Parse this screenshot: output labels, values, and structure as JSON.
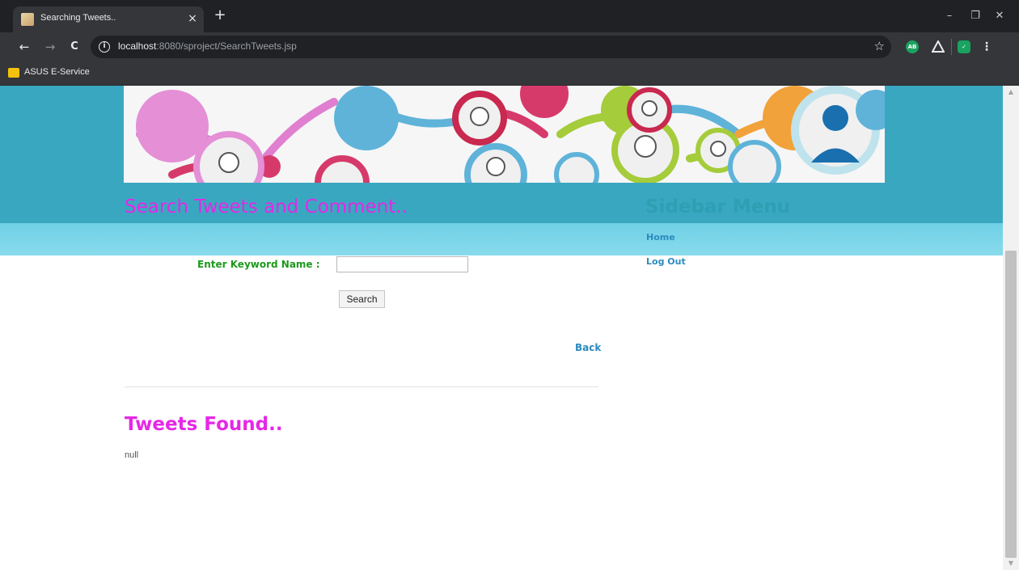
{
  "browser": {
    "tab_title": "Searching Tweets..",
    "tab_close": "×",
    "new_tab": "+",
    "url_host": "localhost",
    "url_rest": ":8080/sproject/SearchTweets.jsp",
    "bookmark": "ASUS E-Service",
    "window_controls": {
      "minimize": "–",
      "restore": "❐",
      "close": "✕"
    },
    "nav": {
      "back": "←",
      "forward": "→",
      "reload": "C"
    },
    "extension_ab": "AB"
  },
  "main": {
    "title": "Search Tweets and Comment..",
    "keyword_label": "Enter Keyword Name :",
    "keyword_value": "",
    "search_button": "Search",
    "back_link": "Back",
    "results_title": "Tweets Found..",
    "results_text": "null"
  },
  "sidebar": {
    "title": "Sidebar Menu",
    "items": [
      {
        "label": "Home"
      },
      {
        "label": "Log Out"
      }
    ]
  },
  "colors": {
    "heading_magenta": "#e528e6",
    "label_green": "#1c9a1c",
    "link_blue": "#2a8bbf",
    "sidebar_teal": "#2d9fb2",
    "header_band": "#3aa7c1"
  }
}
